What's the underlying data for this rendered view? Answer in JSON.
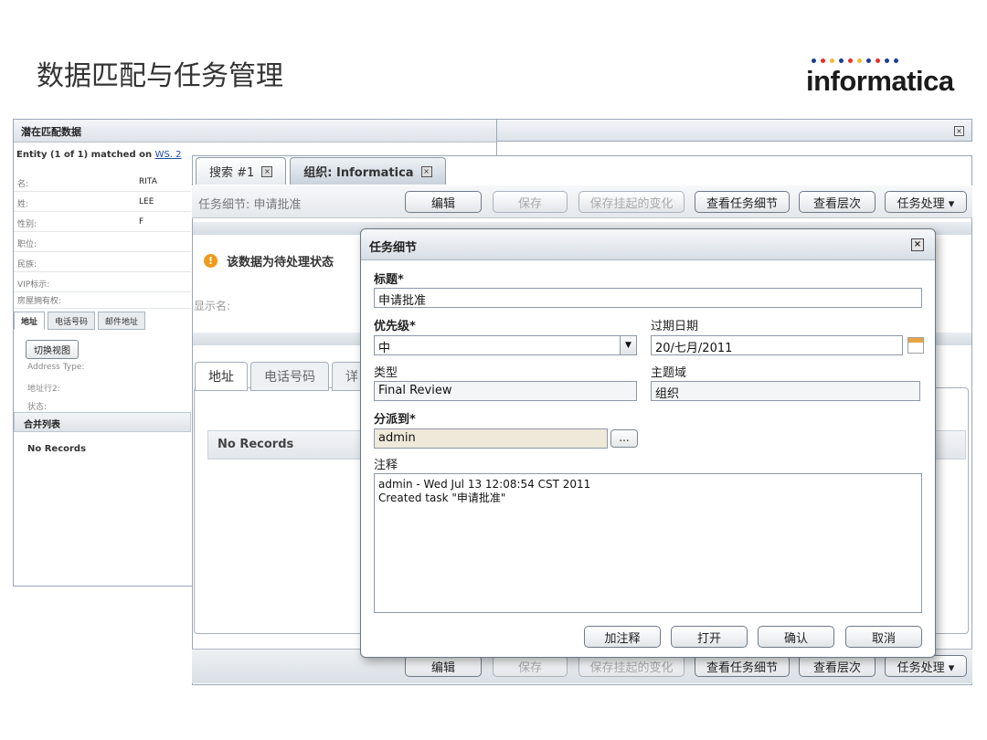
{
  "slide": {
    "title": "数据匹配与任务管理",
    "logo_text": "informatica",
    "logo_dot_colors": [
      "#1b3f8f",
      "#e4322b",
      "#f5b82e",
      "#1b3f8f",
      "#e4322b",
      "#f5b82e",
      "#1b3f8f",
      "#e4322b",
      "#1b3f8f",
      "#1b3f8f"
    ]
  },
  "back_panel": {
    "header": "潜在匹配数据",
    "matched_prefix": "Entity (1 of 1) matched on",
    "matched_link": "WS. 2",
    "fields": [
      {
        "label": "名:",
        "value": "RITA"
      },
      {
        "label": "姓:",
        "value": "LEE"
      },
      {
        "label": "性别:",
        "value": "F"
      },
      {
        "label": "职位:",
        "value": ""
      },
      {
        "label": "民族:",
        "value": ""
      },
      {
        "label": "VIP标示:",
        "value": ""
      },
      {
        "label": "房屋拥有权:",
        "value": ""
      }
    ],
    "tabs": [
      "地址",
      "电话号码",
      "邮件地址"
    ],
    "switch_view": "切换视图",
    "address_type": "Address Type:",
    "address_line2": "地址行2:",
    "status": "状态:",
    "merge_list": "合并列表",
    "no_records": "No Records"
  },
  "main": {
    "tabs": [
      {
        "label": "搜索 #1"
      },
      {
        "label": "组织: Informatica"
      }
    ],
    "toolbar_label": "任务细节: 申请批准",
    "toolbar_buttons": {
      "edit": "编辑",
      "save": "保存",
      "save_pending": "保存挂起的变化",
      "view_task": "查看任务细节",
      "view_hierarchy": "查看层次",
      "task_action": "任务处理 ▾"
    },
    "warning": "该数据为待处理状态",
    "display_name_label": "显示名:",
    "sub_tabs": [
      "地址",
      "电话号码",
      "详"
    ],
    "no_records": "No Records"
  },
  "dialog": {
    "title": "任务细节",
    "title_label": "标题*",
    "title_value": "申请批准",
    "priority_label": "优先级*",
    "priority_value": "中",
    "due_date_label": "过期日期",
    "due_date_value": "20/七月/2011",
    "type_label": "类型",
    "type_value": "Final Review",
    "subject_label": "主题域",
    "subject_value": "组织",
    "assign_label": "分派到*",
    "assign_value": "admin",
    "dots": "...",
    "notes_label": "注释",
    "notes_line1": "admin - Wed Jul 13 12:08:54 CST 2011",
    "notes_line2": "Created task \"申请批准\"",
    "buttons": {
      "add_note": "加注释",
      "open": "打开",
      "confirm": "确认",
      "cancel": "取消"
    }
  }
}
